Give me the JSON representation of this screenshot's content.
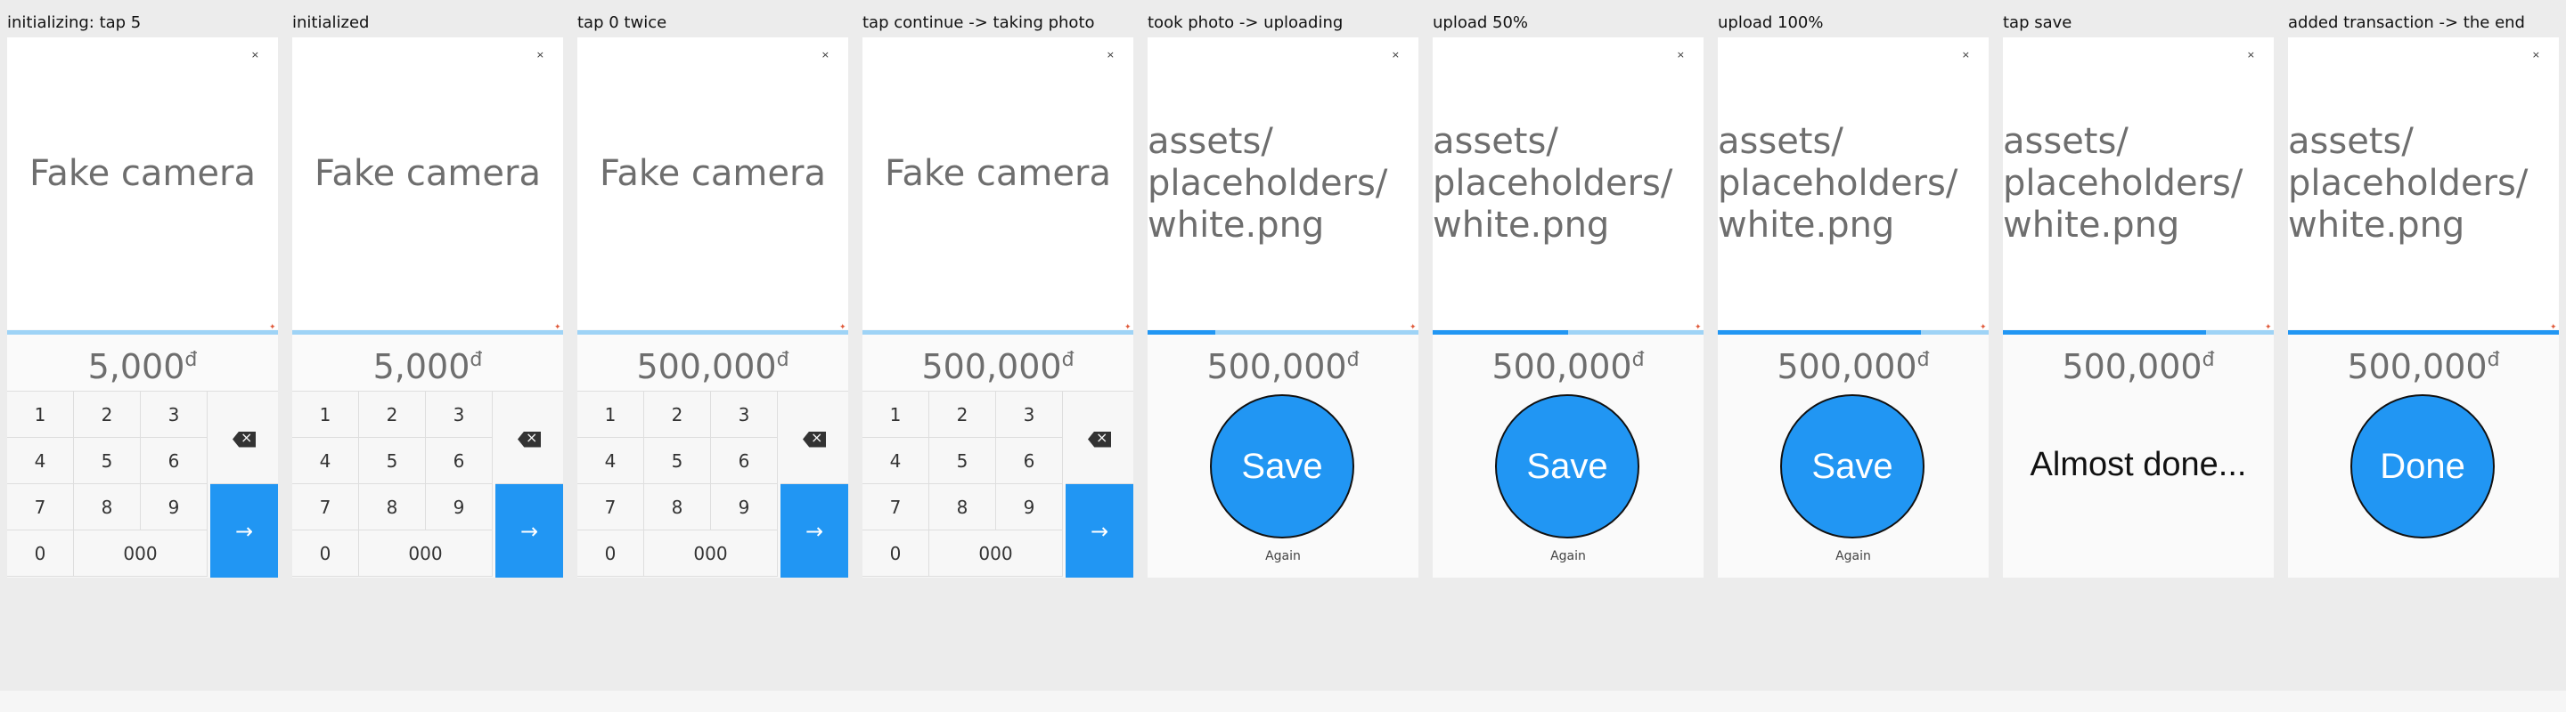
{
  "frames": [
    {
      "caption": "initializing: tap 5",
      "camera_text": "Fake camera",
      "camera_close_icon": "close-icon",
      "progress_fraction": 0.0,
      "amount": "5,000",
      "currency": "đ",
      "mode": "keypad"
    },
    {
      "caption": "initialized",
      "camera_text": "Fake camera",
      "camera_close_icon": "close-icon",
      "progress_fraction": 0.0,
      "amount": "5,000",
      "currency": "đ",
      "mode": "keypad"
    },
    {
      "caption": "tap 0 twice",
      "camera_text": "Fake camera",
      "camera_close_icon": "close-icon",
      "progress_fraction": 0.0,
      "amount": "500,000",
      "currency": "đ",
      "mode": "keypad"
    },
    {
      "caption": "tap continue -> taking photo",
      "camera_text": "Fake camera",
      "camera_close_icon": "close-icon",
      "progress_fraction": 0.0,
      "amount": "500,000",
      "currency": "đ",
      "mode": "keypad"
    },
    {
      "caption": "took photo -> uploading",
      "camera_asset": "assets/\nplaceholders/\nwhite.png",
      "camera_close_icon": "close-icon",
      "progress_fraction": 0.25,
      "amount": "500,000",
      "currency": "đ",
      "mode": "save",
      "button_label": "Save",
      "secondary_label": "Again"
    },
    {
      "caption": "upload 50%",
      "camera_asset": "assets/\nplaceholders/\nwhite.png",
      "camera_close_icon": "close-icon",
      "progress_fraction": 0.5,
      "amount": "500,000",
      "currency": "đ",
      "mode": "save",
      "button_label": "Save",
      "secondary_label": "Again"
    },
    {
      "caption": "upload 100%",
      "camera_asset": "assets/\nplaceholders/\nwhite.png",
      "camera_close_icon": "close-icon",
      "progress_fraction": 0.75,
      "amount": "500,000",
      "currency": "đ",
      "mode": "save",
      "button_label": "Save",
      "secondary_label": "Again"
    },
    {
      "caption": "tap save",
      "camera_asset": "assets/\nplaceholders/\nwhite.png",
      "camera_close_icon": "close-icon",
      "progress_fraction": 0.75,
      "amount": "500,000",
      "currency": "đ",
      "mode": "almost",
      "status_text": "Almost done..."
    },
    {
      "caption": "added transaction -> the end",
      "camera_asset": "assets/\nplaceholders/\nwhite.png",
      "camera_close_icon": "close-icon",
      "progress_fraction": 1.0,
      "amount": "500,000",
      "currency": "đ",
      "mode": "done",
      "button_label": "Done"
    }
  ],
  "keypad": {
    "keys": [
      "1",
      "2",
      "3",
      "4",
      "5",
      "6",
      "7",
      "8",
      "9",
      "0",
      "000"
    ],
    "backspace_icon": "backspace-icon",
    "submit_icon": "arrow-right-icon",
    "submit_glyph": "→"
  },
  "colors": {
    "accent": "#2196f3",
    "progress_track": "#9ed3f6"
  }
}
